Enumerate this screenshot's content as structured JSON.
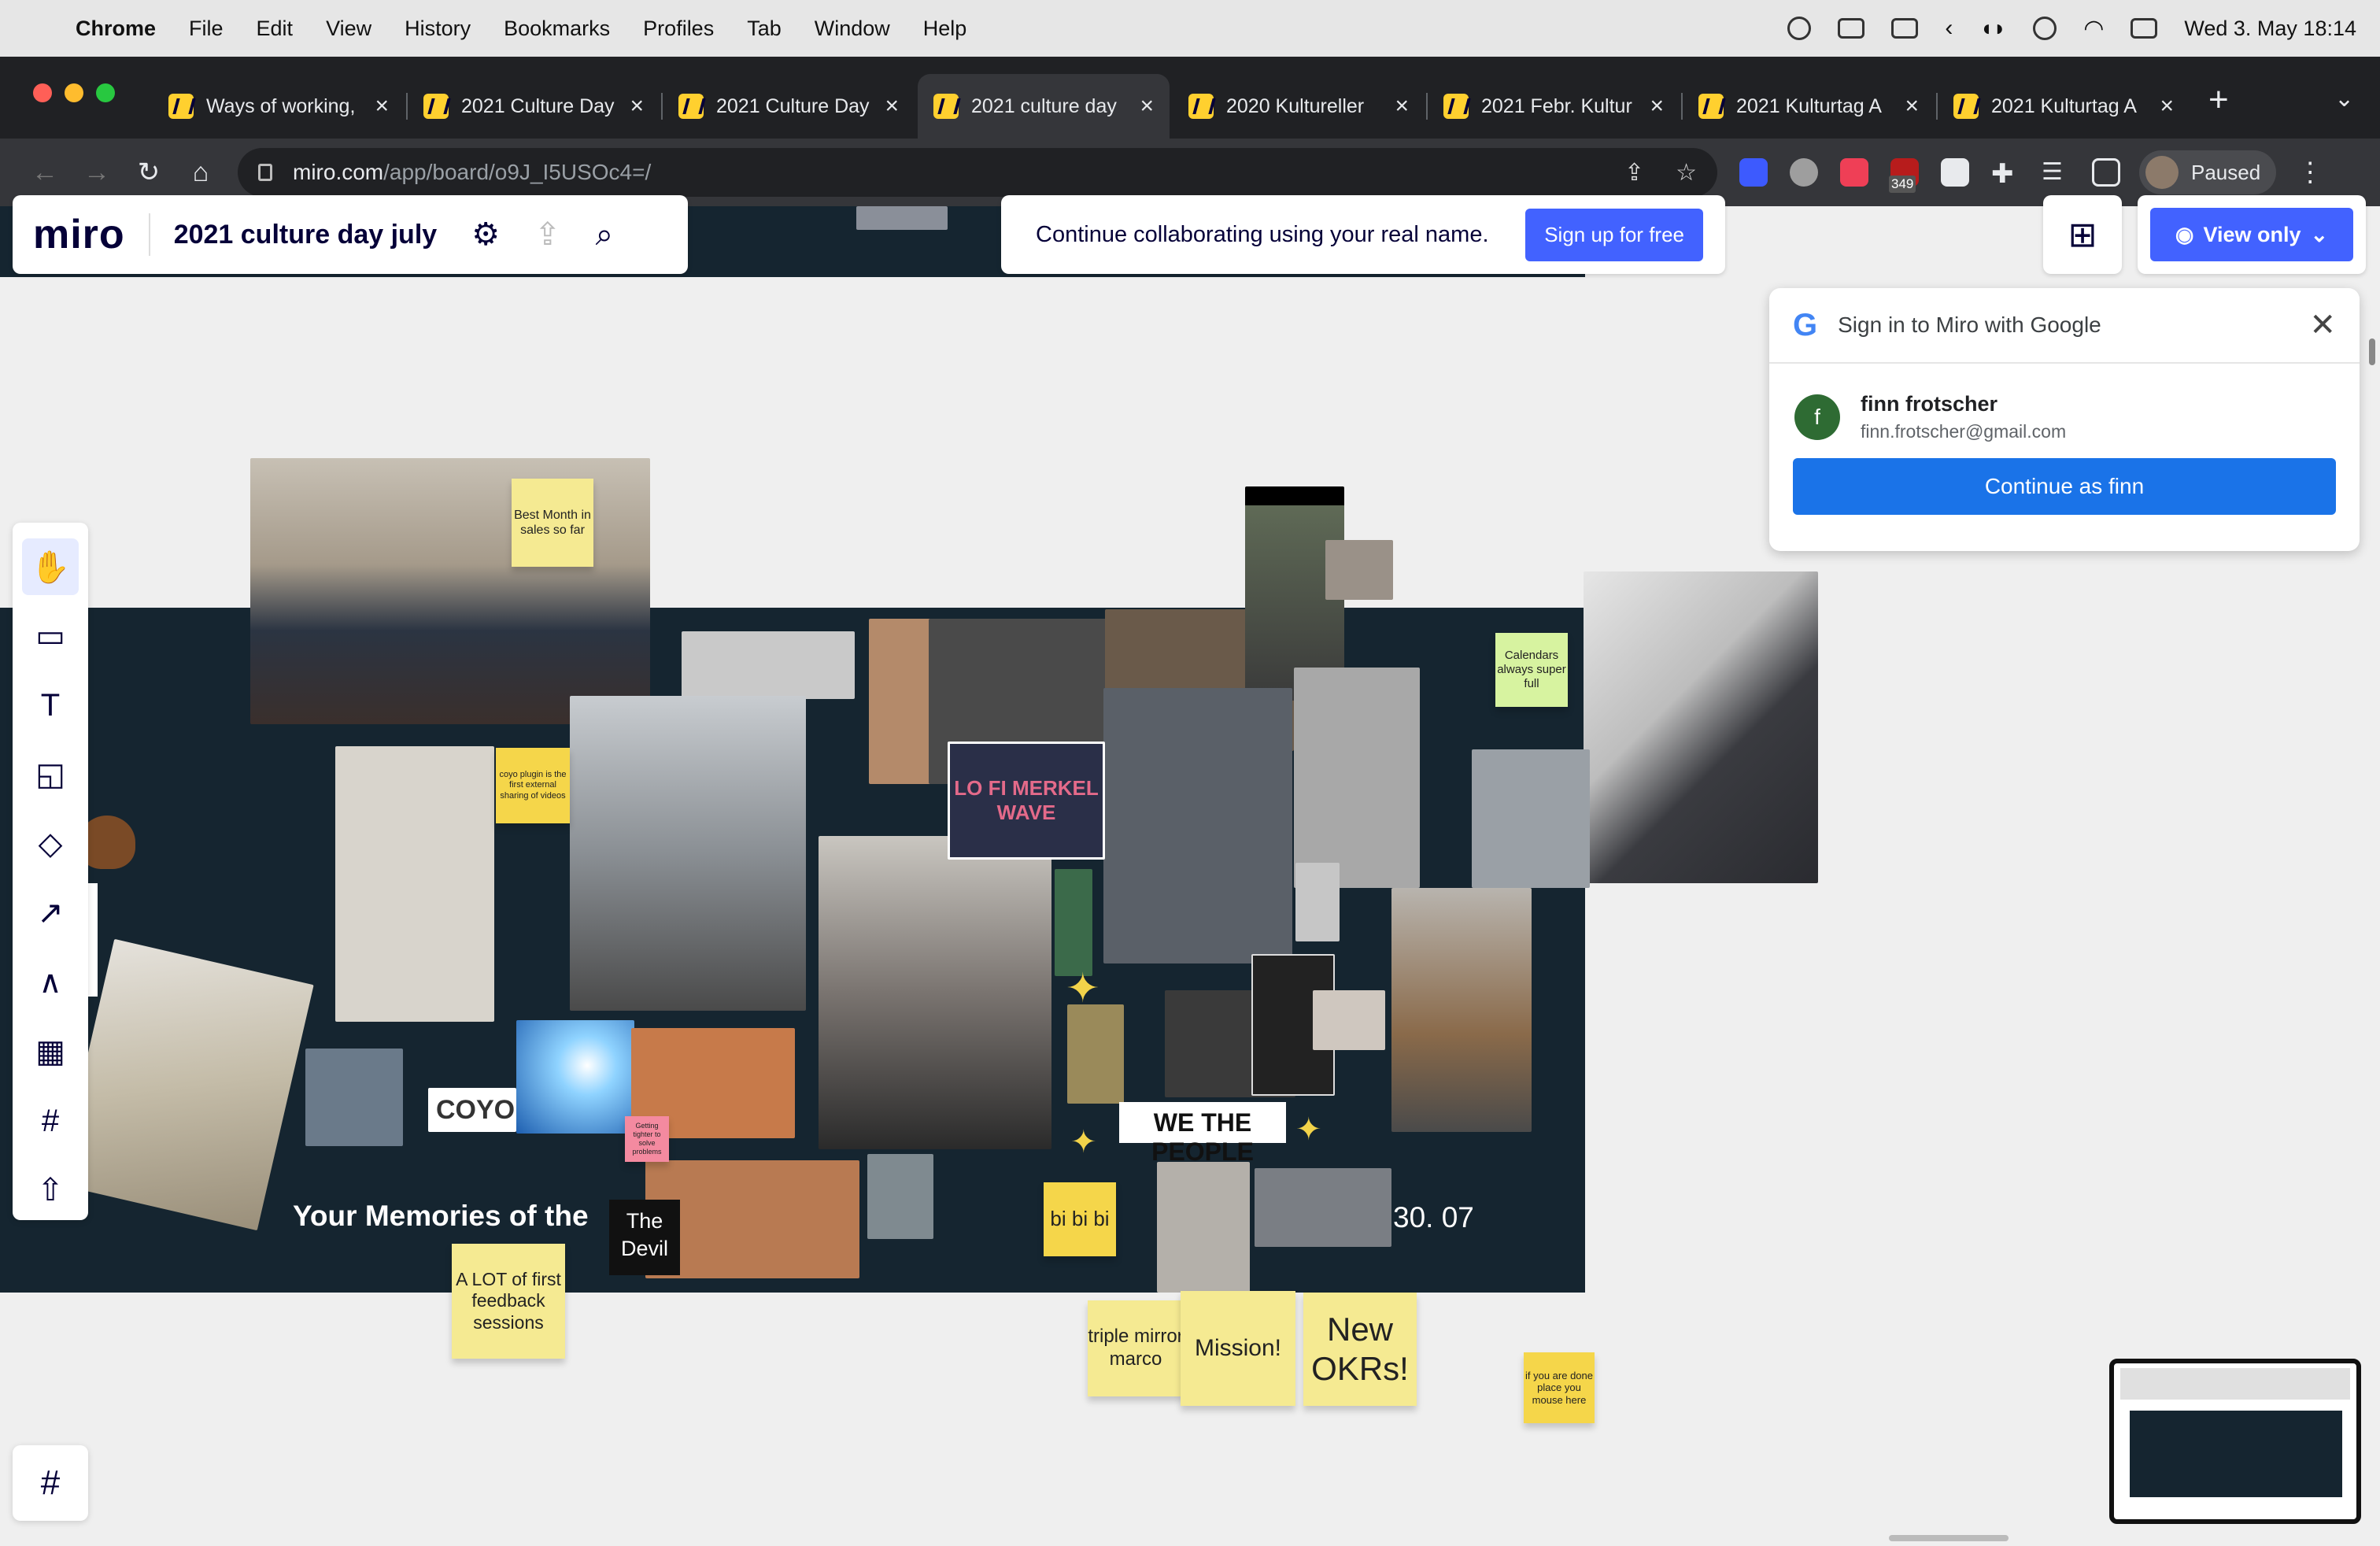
{
  "menubar": {
    "app": "Chrome",
    "items": [
      "File",
      "Edit",
      "View",
      "History",
      "Bookmarks",
      "Profiles",
      "Tab",
      "Window",
      "Help"
    ],
    "datetime": "Wed 3. May  18:14"
  },
  "tabs": [
    {
      "title": "Ways of working,"
    },
    {
      "title": "2021 Culture Day"
    },
    {
      "title": "2021 Culture Day"
    },
    {
      "title": "2021 culture day"
    },
    {
      "title": "2020 Kultureller"
    },
    {
      "title": "2021 Febr. Kultur"
    },
    {
      "title": "2021 Kulturtag A"
    },
    {
      "title": "2021 Kulturtag A"
    }
  ],
  "address": {
    "host": "miro.com",
    "path": "/app/board/o9J_I5USOc4=/",
    "badge": "349",
    "profile_status": "Paused"
  },
  "miro": {
    "logo": "miro",
    "board_name": "2021 culture day july",
    "collab_message": "Continue collaborating using your real name.",
    "signup_label": "Sign up for free",
    "view_only_label": "View only"
  },
  "google_popup": {
    "title": "Sign in to Miro with Google",
    "avatar_letter": "f",
    "name": "finn frotscher",
    "email": "finn.frotscher@gmail.com",
    "button": "Continue as finn"
  },
  "board": {
    "title_text": "Your Memories of the",
    "devil_text": "The Devil",
    "date_text": "30. 07",
    "we_the_people": "WE THE PEOPLE",
    "coyo_text": "COYO",
    "lofi_text": "LO FI MERKEL WAVE",
    "stickies": {
      "best_month": "Best Month in sales so far",
      "coyo_plugin": "coyo plugin is the first external sharing of videos",
      "calendars": "Calendars always super full",
      "feedback": "A LOT of first feedback sessions",
      "bibibi": "bi bi bi",
      "triple": "triple mirror marco",
      "mission": "Mission!",
      "okrs": "New OKRs!",
      "mouse": "if you are done place you mouse here",
      "getting": "Getting tighter to solve problems"
    }
  },
  "colors": {
    "miro_blue": "#4262ff",
    "google_blue": "#1a73e8",
    "board_bg": "#152530",
    "sticky_yellow": "#f5ea92"
  }
}
